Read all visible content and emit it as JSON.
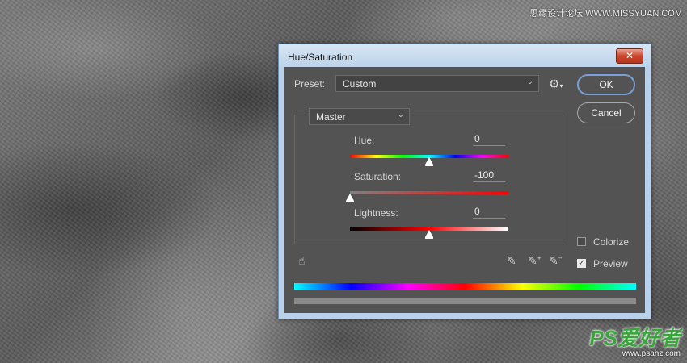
{
  "watermark": {
    "top_text": "思缘设计论坛 WWW.MISSYUAN.COM",
    "logo_text": "PS爱好者",
    "logo_sub": "www.psahz.com"
  },
  "dialog": {
    "title": "Hue/Saturation",
    "close_glyph": "✕",
    "preset_label": "Preset:",
    "preset_value": "Custom",
    "preset_options_icon": "gear-icon",
    "ok_label": "OK",
    "cancel_label": "Cancel",
    "channel_value": "Master",
    "sliders": [
      {
        "label": "Hue:",
        "value": "0",
        "fraction": 0.5
      },
      {
        "label": "Saturation:",
        "value": "-100",
        "fraction": 0.0
      },
      {
        "label": "Lightness:",
        "value": "0",
        "fraction": 0.5
      }
    ],
    "colorize_label": "Colorize",
    "colorize_checked": false,
    "preview_label": "Preview",
    "preview_checked": true,
    "icons": [
      "targeted-adjustment-hand-icon",
      "eyedropper-icon",
      "eyedropper-add-icon",
      "eyedropper-subtract-icon"
    ],
    "colors": {
      "accent": "#79a0d6",
      "panel": "#535353",
      "title_bar": "#bcd3ea"
    }
  }
}
